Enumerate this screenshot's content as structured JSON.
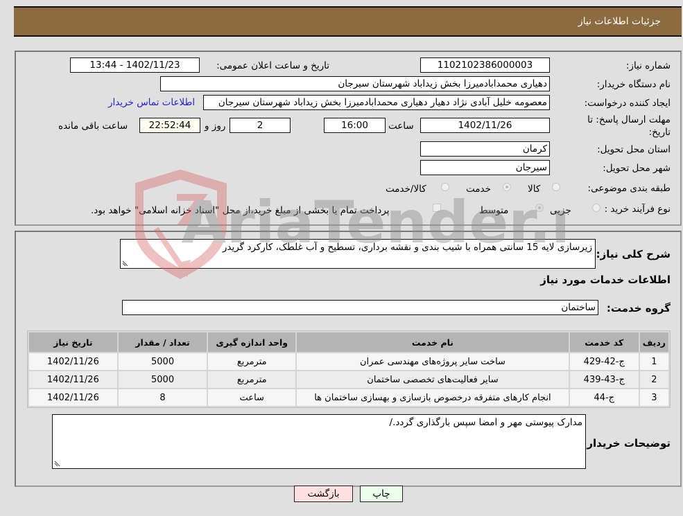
{
  "header": {
    "title": "جزئیات اطلاعات نیاز"
  },
  "details": {
    "need_number": {
      "label": "شماره نیاز:",
      "value": "1102102386000003"
    },
    "announce_datetime": {
      "label": "تاریخ و ساعت اعلان عمومی:",
      "value": "1402/11/23 - 13:44"
    },
    "buyer_org": {
      "label": "نام دستگاه خریدار:",
      "value": "دهیاری محمدابادمیرزا بخش زیداباد شهرستان سیرجان"
    },
    "requester": {
      "label": "ایجاد کننده درخواست:",
      "value": "معصومه خلیل آبادی نژاد دهیار دهیاری محمدابادمیرزا بخش زیداباد شهرستان سیرجان"
    },
    "buyer_contact_link": "اطلاعات تماس خریدار",
    "deadline": {
      "label": "مهلت ارسال پاسخ: تا تاریخ:",
      "date": "1402/11/26",
      "time_label": "ساعت",
      "time": "16:00",
      "days": "2",
      "days_label": "روز و",
      "remaining": "22:52:44",
      "remaining_label": "ساعت باقی مانده"
    },
    "province": {
      "label": "استان محل تحویل:",
      "value": "کرمان"
    },
    "city": {
      "label": "شهر محل تحویل:",
      "value": "سیرجان"
    },
    "category": {
      "label": "طبقه بندی موضوعی:",
      "options": [
        "کالا",
        "خدمت",
        "کالا/خدمت"
      ],
      "selected": "خدمت"
    },
    "purchase_type": {
      "label": "نوع فرآیند خرید :",
      "options": [
        "جزیی",
        "متوسط"
      ],
      "selected": "متوسط",
      "treasury_note": "پرداخت تمام یا بخشی از مبلغ خرید،از محل \"اسناد خزانه اسلامی\" خواهد بود."
    }
  },
  "description": {
    "label": "شرح کلی نیاز:",
    "value": "زیرسازی لایه 15 سانتی همراه با شیب بندی و نقشه برداری، تسطیح و آب غلطک، کارکرد گریدر"
  },
  "services": {
    "section_title": "اطلاعات خدمات مورد نیاز",
    "group_label": "گروه خدمت:",
    "group_value": "ساختمان",
    "columns": [
      "ردیف",
      "کد خدمت",
      "نام خدمت",
      "واحد اندازه گیری",
      "تعداد / مقدار",
      "تاریخ نیاز"
    ],
    "rows": [
      {
        "row": "1",
        "code": "ج-42-429",
        "name": "ساخت سایر پروژه‌های مهندسی عمران",
        "unit": "مترمربع",
        "qty": "5000",
        "date": "1402/11/26"
      },
      {
        "row": "2",
        "code": "ج-43-439",
        "name": "سایر فعالیت‌های تخصصی ساختمان",
        "unit": "مترمربع",
        "qty": "5000",
        "date": "1402/11/26"
      },
      {
        "row": "3",
        "code": "ج-44",
        "name": "انجام کارهای متفرقه درخصوص بازسازی و بهسازی ساختمان ها",
        "unit": "ساعت",
        "qty": "8",
        "date": "1402/11/26"
      }
    ]
  },
  "buyer_notes": {
    "label": "توضیحات خریدار:",
    "value": "مدارک پیوستی مهر و امضا سپس بارگذاری گردد./"
  },
  "buttons": {
    "print": "چاپ",
    "back": "بازگشت"
  },
  "watermark": {
    "text": "AriaTender.neT"
  },
  "colors": {
    "header_bg": "#8c6b40",
    "link": "#2222cc",
    "print_bg": "#eaffea",
    "back_bg": "#ffe0e0"
  }
}
